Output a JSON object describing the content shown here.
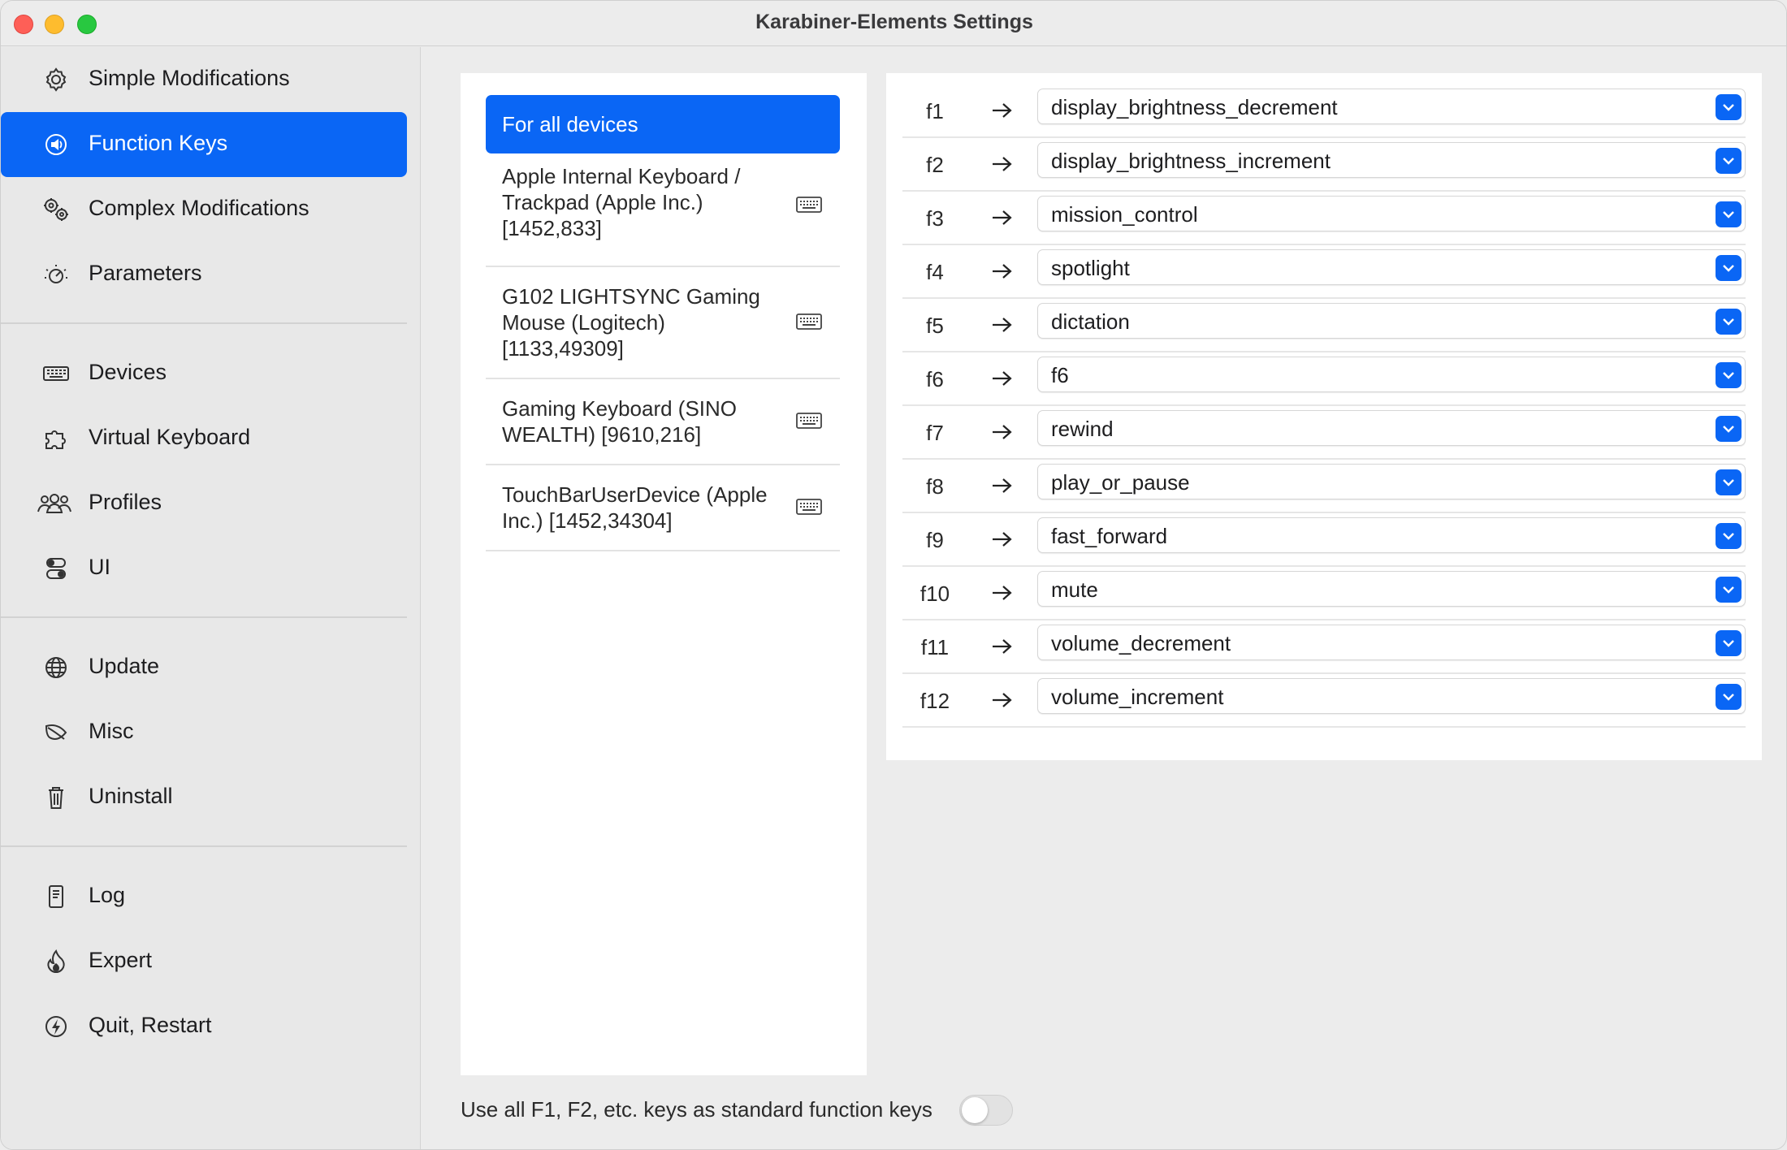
{
  "window": {
    "title": "Karabiner-Elements Settings"
  },
  "sidebar": {
    "items": [
      {
        "label": "Simple Modifications",
        "icon": "gear-icon",
        "active": false
      },
      {
        "label": "Function Keys",
        "icon": "speaker-icon",
        "active": true
      },
      {
        "label": "Complex Modifications",
        "icon": "gears-icon",
        "active": false
      },
      {
        "label": "Parameters",
        "icon": "dial-icon",
        "active": false
      },
      {
        "label": "Devices",
        "icon": "keyboard-icon",
        "active": false
      },
      {
        "label": "Virtual Keyboard",
        "icon": "puzzle-icon",
        "active": false
      },
      {
        "label": "Profiles",
        "icon": "people-icon",
        "active": false
      },
      {
        "label": "UI",
        "icon": "toggles-icon",
        "active": false
      },
      {
        "label": "Update",
        "icon": "globe-icon",
        "active": false
      },
      {
        "label": "Misc",
        "icon": "leaf-icon",
        "active": false
      },
      {
        "label": "Uninstall",
        "icon": "trash-icon",
        "active": false
      },
      {
        "label": "Log",
        "icon": "document-icon",
        "active": false
      },
      {
        "label": "Expert",
        "icon": "flame-icon",
        "active": false
      },
      {
        "label": "Quit, Restart",
        "icon": "bolt-icon",
        "active": false
      }
    ]
  },
  "devices": {
    "items": [
      {
        "name": "For all devices",
        "selected": true
      },
      {
        "name": "Apple Internal Keyboard /\nTrackpad (Apple Inc.)\n[1452,833]",
        "selected": false
      },
      {
        "name": "G102 LIGHTSYNC Gaming\nMouse (Logitech)\n[1133,49309]",
        "selected": false
      },
      {
        "name": "Gaming Keyboard (SINO\nWEALTH) [9610,216]",
        "selected": false
      },
      {
        "name": "TouchBarUserDevice (Apple\nInc.) [1452,34304]",
        "selected": false
      }
    ]
  },
  "function_keys": {
    "rows": [
      {
        "key": "f1",
        "value": "display_brightness_decrement"
      },
      {
        "key": "f2",
        "value": "display_brightness_increment"
      },
      {
        "key": "f3",
        "value": "mission_control"
      },
      {
        "key": "f4",
        "value": "spotlight"
      },
      {
        "key": "f5",
        "value": "dictation"
      },
      {
        "key": "f6",
        "value": "f6"
      },
      {
        "key": "f7",
        "value": "rewind"
      },
      {
        "key": "f8",
        "value": "play_or_pause"
      },
      {
        "key": "f9",
        "value": "fast_forward"
      },
      {
        "key": "f10",
        "value": "mute"
      },
      {
        "key": "f11",
        "value": "volume_decrement"
      },
      {
        "key": "f12",
        "value": "volume_increment"
      }
    ]
  },
  "footer": {
    "toggle_label": "Use all F1, F2, etc. keys as standard function keys",
    "toggle_on": false
  },
  "colors": {
    "accent": "#0a66f5",
    "sidebar_bg": "#e8e8e8",
    "panel_bg": "#ffffff"
  }
}
